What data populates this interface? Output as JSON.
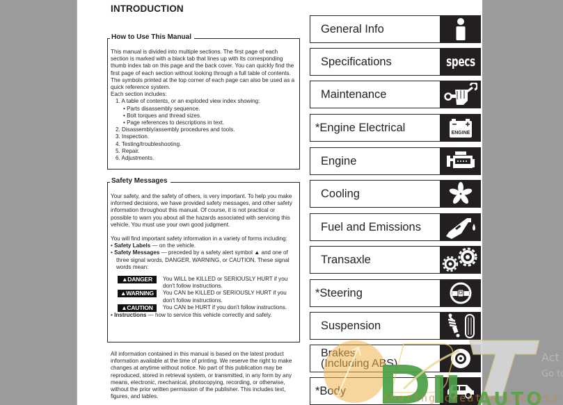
{
  "page": {
    "title": "INTRODUCTION",
    "how_to_use": {
      "heading": "How to Use This Manual",
      "intro": "This manual is divided into multiple sections. The first page of each section is marked with a black tab that lines up with its corresponding thumb index tab on this page and the back cover. You can quickly find the first page of each section without looking through a full table of contents. The symbols printed at the top corner of each page can also be used as a quick reference system.",
      "each_section": "Each section includes:",
      "items": [
        "1.  A table of contents, or an exploded view index showing:",
        "2.  Disassembly/assembly procedures and tools.",
        "3.  Inspection.",
        "4.  Testing/troubleshooting.",
        "5.  Repair.",
        "6.  Adjustments."
      ],
      "subitems": [
        "• Parts disassembly sequence.",
        "• Bolt torques and thread sizes.",
        "• Page references to descriptions in text."
      ]
    },
    "safety": {
      "heading": "Safety Messages",
      "para1": "Your safety, and the safety of others, is very important. To help you make informed decisions, we have provided safety messages, and other safety information throughout this manual. Of course, it is not practical or possible to warn you about all the hazards associated with servicing this vehicle. You must use your own good judgment.",
      "para2": "You will find important safety information in a variety of forms including:",
      "labels_bold": "Safety Labels",
      "labels_rest": " — on the vehicle.",
      "messages_bold": "Safety Messages",
      "messages_rest": " — preceded by a safety alert symbol ▲ and one of three signal words, DANGER, WARNING, or CAUTION. These signal words mean:",
      "signals": [
        {
          "word": "▲DANGER",
          "meaning": "You WILL be KILLED or SERIOUSLY HURT if you don't follow instructions."
        },
        {
          "word": "▲WARNING",
          "meaning": "You CAN be KILLED or SERIOUSLY HURT if you don't follow instructions."
        },
        {
          "word": "▲CAUTION",
          "meaning": "You CAN be HURT if you don't follow instructions."
        }
      ],
      "instructions_bold": "Instructions",
      "instructions_rest": " — how to service this vehicle correctly and safely."
    },
    "disclaimer": "All information contained in this manual is based on the latest product information available at the time of printing. We reserve the right to make changes at anytime without notice. No part of this publication may be reproduced, stored in retrieval system, or transmitted, in any form by any means, electronic, mechanical, photocopying, recording, or otherwise, without the prior written permission of the publisher. This includes text, figures, and tables."
  },
  "tabs": [
    {
      "label": "General Info",
      "icon": "info-icon"
    },
    {
      "label": "Specifications",
      "icon": "specs-icon",
      "icon_text": "specs"
    },
    {
      "label": "Maintenance",
      "icon": "wrench-fist-icon"
    },
    {
      "label": "*Engine Electrical",
      "icon": "battery-icon",
      "icon_text": "ENGINE"
    },
    {
      "label": "Engine",
      "icon": "engine-icon"
    },
    {
      "label": "Cooling",
      "icon": "fan-icon"
    },
    {
      "label": "Fuel and Emissions",
      "icon": "fuel-nozzle-icon"
    },
    {
      "label": "Transaxle",
      "icon": "gears-icon"
    },
    {
      "label": "*Steering",
      "icon": "steering-wheel-icon"
    },
    {
      "label": "Suspension",
      "icon": "shock-tire-icon"
    },
    {
      "label": "Brakes\n(Including ABS)",
      "label_line1": "Brakes",
      "label_line2": "(Including ABS)",
      "icon": "brake-disc-icon"
    },
    {
      "label": "*Body",
      "icon": "car-body-icon"
    }
  ],
  "watermark": {
    "brand": "DHT AUTO",
    "slogan": "Sharing creates success",
    "os_notice_line1": "Act",
    "os_notice_line2": "Go to"
  }
}
